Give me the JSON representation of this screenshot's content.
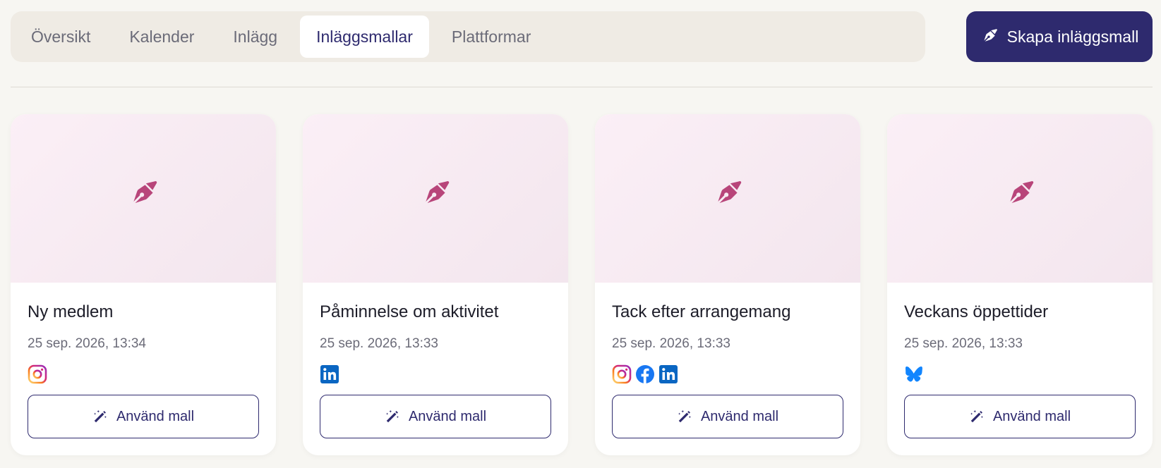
{
  "colors": {
    "brand": "#2e2a6e",
    "accent_pink": "#b8457a",
    "instagram": "#e1306c",
    "facebook": "#1877f2",
    "linkedin": "#0a66c2",
    "bluesky": "#1185fe"
  },
  "tabs": [
    {
      "label": "Översikt",
      "active": false
    },
    {
      "label": "Kalender",
      "active": false
    },
    {
      "label": "Inlägg",
      "active": false
    },
    {
      "label": "Inläggsmallar",
      "active": true
    },
    {
      "label": "Plattformar",
      "active": false
    }
  ],
  "create_button": {
    "label": "Skapa inläggsmall",
    "icon": "pen-nib-icon"
  },
  "templates": [
    {
      "title": "Ny medlem",
      "date": "25 sep. 2026, 13:34",
      "platforms": [
        "instagram"
      ],
      "button_label": "Använd mall"
    },
    {
      "title": "Påminnelse om aktivitet",
      "date": "25 sep. 2026, 13:33",
      "platforms": [
        "linkedin"
      ],
      "button_label": "Använd mall"
    },
    {
      "title": "Tack efter arrangemang",
      "date": "25 sep. 2026, 13:33",
      "platforms": [
        "instagram",
        "facebook",
        "linkedin"
      ],
      "button_label": "Använd mall"
    },
    {
      "title": "Veckans öppettider",
      "date": "25 sep. 2026, 13:33",
      "platforms": [
        "bluesky"
      ],
      "button_label": "Använd mall"
    }
  ]
}
